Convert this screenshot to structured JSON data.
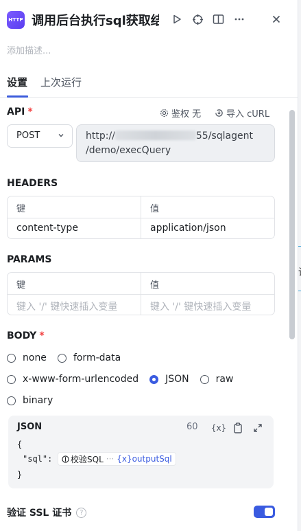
{
  "header": {
    "app_icon_text": "HTTP",
    "title": "调用后台执行sql获取结",
    "description_placeholder": "添加描述..."
  },
  "tabs": [
    {
      "label": "设置",
      "active": true
    },
    {
      "label": "上次运行",
      "active": false
    }
  ],
  "api": {
    "label": "API",
    "required_mark": "*",
    "auth_label": "鉴权 无",
    "import_label": "导入 cURL",
    "method": "POST",
    "url_prefix": "http://",
    "url_suffix": "55/sqlagent",
    "url_line2": "/demo/execQuery"
  },
  "headers": {
    "label": "HEADERS",
    "col_key": "键",
    "col_value": "值",
    "rows": [
      {
        "key": "content-type",
        "value": "application/json"
      }
    ]
  },
  "params": {
    "label": "PARAMS",
    "col_key": "键",
    "col_value": "值",
    "key_placeholder": "键入 '/' 键快速插入变量",
    "value_placeholder": "键入 '/' 键快速插入变量"
  },
  "body": {
    "label": "BODY",
    "required_mark": "*",
    "options": [
      "none",
      "form-data",
      "x-www-form-urlencoded",
      "JSON",
      "raw",
      "binary"
    ],
    "selected": "JSON"
  },
  "json_editor": {
    "title": "JSON",
    "count": "60",
    "var_icon_text": "{x}",
    "line1": "{",
    "key": "\"sql\":",
    "node_name": "校验SQL",
    "ellipsis": "···",
    "var_name": "{x}outputSql",
    "line3": "}"
  },
  "ssl": {
    "label": "验证 SSL 证书",
    "help": "?",
    "enabled": true
  },
  "colors": {
    "accent": "#3a5be0",
    "required": "#f23c3c",
    "app_icon": "#6a4bf5"
  }
}
